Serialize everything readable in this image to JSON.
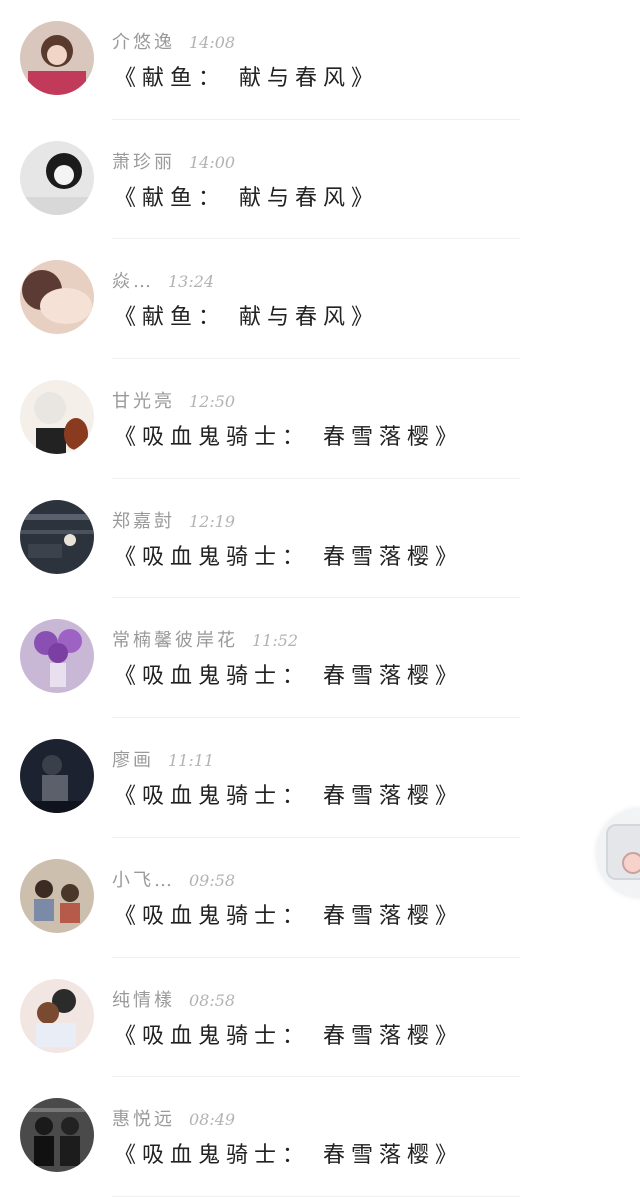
{
  "comments": [
    {
      "name": "介悠逸",
      "time": "14:08",
      "title": "《献鱼： 献与春风》"
    },
    {
      "name": "萧珍丽",
      "time": "14:00",
      "title": "《献鱼： 献与春风》"
    },
    {
      "name": "焱…",
      "time": "13:24",
      "title": "《献鱼： 献与春风》"
    },
    {
      "name": "甘光亮",
      "time": "12:50",
      "title": "《吸血鬼骑士： 春雪落樱》"
    },
    {
      "name": "郑嘉尌",
      "time": "12:19",
      "title": "《吸血鬼骑士： 春雪落樱》"
    },
    {
      "name": "常楠馨彼岸花",
      "time": "11:52",
      "title": "《吸血鬼骑士： 春雪落樱》"
    },
    {
      "name": "廖画",
      "time": "11:11",
      "title": "《吸血鬼骑士： 春雪落樱》"
    },
    {
      "name": "小飞…",
      "time": "09:58",
      "title": "《吸血鬼骑士： 春雪落樱》"
    },
    {
      "name": "纯情樣",
      "time": "08:58",
      "title": "《吸血鬼骑士： 春雪落樱》"
    },
    {
      "name": "惠悦远",
      "time": "08:49",
      "title": "《吸血鬼骑士： 春雪落樱》"
    }
  ],
  "avatar_colors": [
    "#c9a7a0",
    "#cfcfcf",
    "#c9a394",
    "#ece4dc",
    "#2f3640",
    "#b598c9",
    "#1f2533",
    "#b09a86",
    "#e7d8d2",
    "#3a3a3a"
  ],
  "float_button": {
    "icon": "avatar-bubble-icon"
  }
}
